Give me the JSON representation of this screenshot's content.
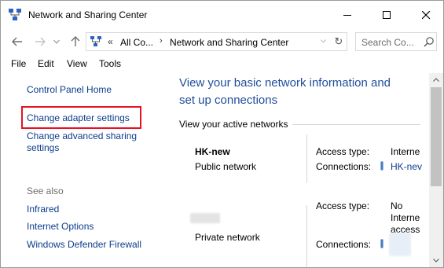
{
  "window": {
    "title": "Network and Sharing Center"
  },
  "address": {
    "overflow": "«",
    "segment1": "All Co...",
    "separator": "›",
    "segment2": "Network and Sharing Center",
    "dropdown": "⌵",
    "refresh": "↻"
  },
  "search": {
    "placeholder": "Search Co..."
  },
  "menu": {
    "file": "File",
    "edit": "Edit",
    "view": "View",
    "tools": "Tools"
  },
  "sidebar": {
    "home": "Control Panel Home",
    "change_adapter": "Change adapter settings",
    "change_sharing_1": "Change advanced sharing",
    "change_sharing_2": "settings",
    "see_also": "See also",
    "items": [
      "Infrared",
      "Internet Options",
      "Windows Defender Firewall"
    ]
  },
  "main": {
    "heading_1": "View your basic network information and",
    "heading_2": "set up connections",
    "active_label": "View your active networks",
    "networks": [
      {
        "name": "HK-new",
        "type": "Public network",
        "access_label": "Access type:",
        "access_value": "Interne",
        "connections_label": "Connections:",
        "connections_value": "HK-nev"
      },
      {
        "name": "",
        "type": "Private network",
        "access_label": "Access type:",
        "access_value_1": "No",
        "access_value_2": "Interne",
        "access_value_3": "access",
        "connections_label": "Connections:",
        "connections_value": ""
      }
    ]
  },
  "colors": {
    "link": "#0b3c8c",
    "heading": "#1e4e9c",
    "highlight": "#e81123"
  }
}
